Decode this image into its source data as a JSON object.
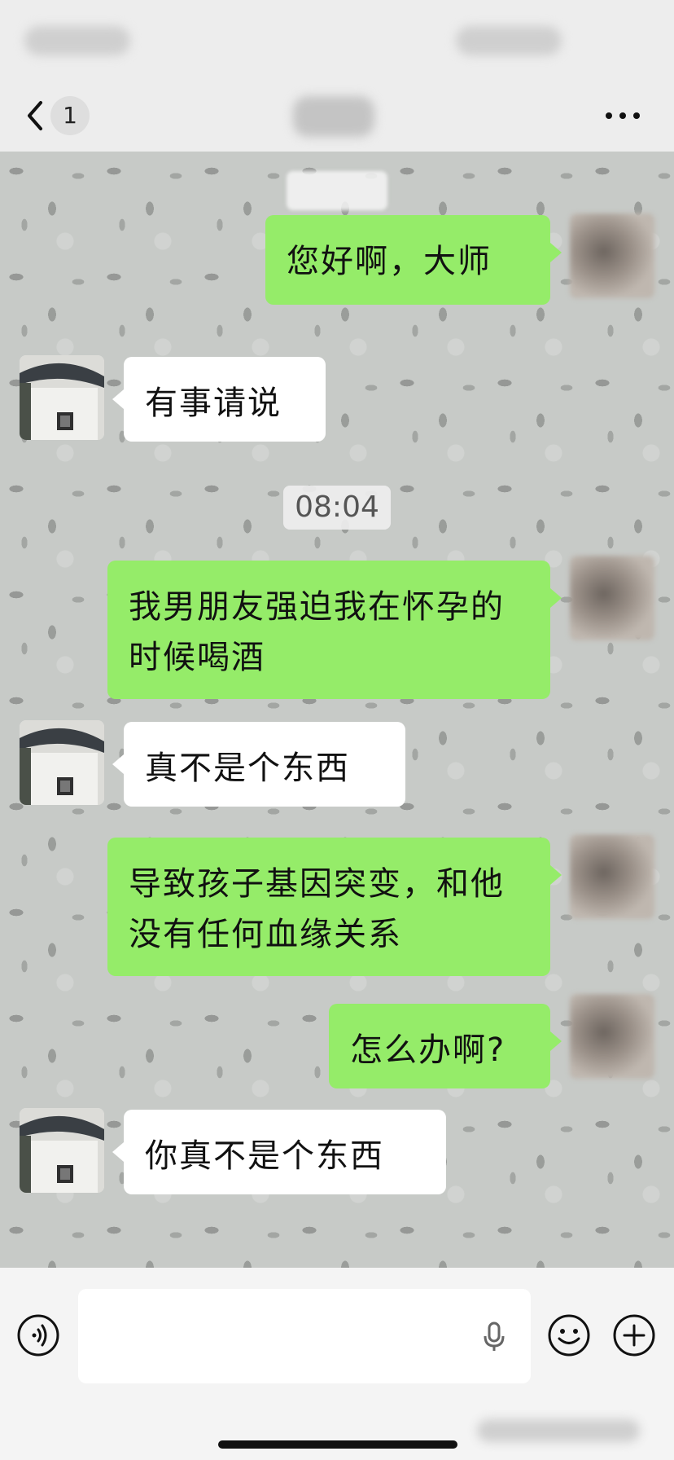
{
  "nav": {
    "unread_count": "1"
  },
  "messages": [
    {
      "side": "out",
      "text": "您好啊，大师"
    },
    {
      "side": "in",
      "text": "有事请说"
    },
    {
      "side": "time",
      "text": "08:04"
    },
    {
      "side": "out",
      "text": "我男朋友强迫我在怀孕的时候喝酒"
    },
    {
      "side": "in",
      "text": "真不是个东西"
    },
    {
      "side": "out",
      "text": "导致孩子基因突变，和他没有任何血缘关系"
    },
    {
      "side": "out",
      "text": "怎么办啊?"
    },
    {
      "side": "in",
      "text": "你真不是个东西"
    }
  ],
  "colors": {
    "outgoing_bubble": "#95ec69",
    "incoming_bubble": "#ffffff",
    "background": "#ededed"
  },
  "icons": [
    "back-icon",
    "more-icon",
    "voice-icon",
    "mic-icon",
    "emoji-icon",
    "plus-icon"
  ]
}
